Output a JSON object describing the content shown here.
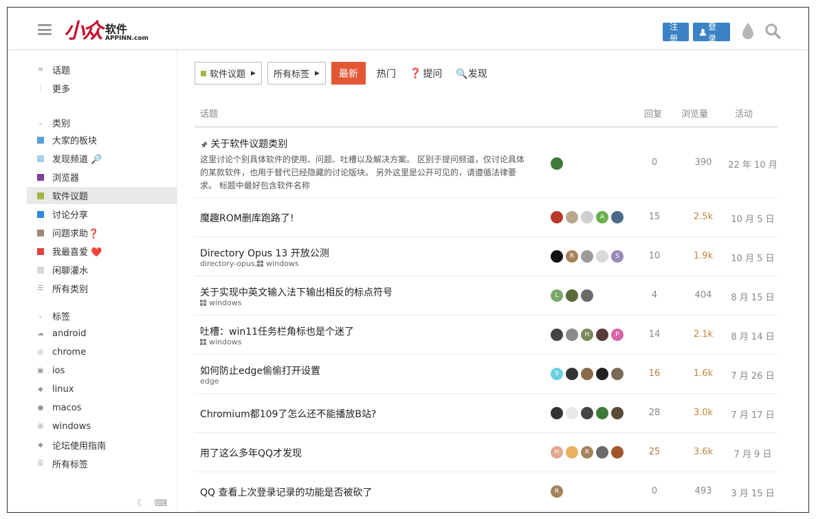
{
  "header": {
    "logo_cn": "软件",
    "logo_en": "APPINN.com",
    "signup_label": "注册",
    "login_label": "登录"
  },
  "sidebar": {
    "top_items": [
      {
        "label": "话题",
        "icon": "layers-icon"
      },
      {
        "label": "更多",
        "icon": "more-vertical-icon"
      }
    ],
    "categories_heading": "类别",
    "categories": [
      {
        "label": "大家的板块",
        "color": "#5aa0d8"
      },
      {
        "label": "发现频道 🔎",
        "color": "#a6d0e4"
      },
      {
        "label": "浏览器",
        "color": "#7d3f98"
      },
      {
        "label": "软件议题",
        "color": "#a3b642",
        "active": true
      },
      {
        "label": "讨论分享",
        "color": "#2a8ae0"
      },
      {
        "label": "问题求助❓",
        "color": "#9e8a7d"
      },
      {
        "label": "我最喜爱 ❤️",
        "color": "#e04040"
      },
      {
        "label": "闲聊灌水",
        "color": "#d8d8d8"
      },
      {
        "label": "所有类别",
        "icon": "list-icon"
      }
    ],
    "tags_heading": "标签",
    "tags": [
      {
        "label": "android",
        "icon": "android-icon"
      },
      {
        "label": "chrome",
        "icon": "chrome-icon"
      },
      {
        "label": "ios",
        "icon": "app-store-icon"
      },
      {
        "label": "linux",
        "icon": "tag-icon"
      },
      {
        "label": "macos",
        "icon": "apple-icon"
      },
      {
        "label": "windows",
        "icon": "windows-icon"
      },
      {
        "label": "论坛使用指南",
        "icon": "tag-icon"
      },
      {
        "label": "所有标签",
        "icon": "list-icon"
      }
    ]
  },
  "nav": {
    "category_dropdown": "软件议题",
    "category_color": "#a3b642",
    "tag_dropdown": "所有标签",
    "latest": "最新",
    "hot": "热门",
    "ask": "提问",
    "ask_mark": "❓",
    "discover": "🔍发现"
  },
  "table": {
    "headers": {
      "topic": "话题",
      "replies": "回复",
      "views": "浏览量",
      "activity": "活动"
    },
    "rows": [
      {
        "title": "关于软件议题类别",
        "pinned": true,
        "excerpt": "这里讨论个别具体软件的使用、问题、吐槽以及解决方案。 区别于提问频道，仅讨论具体的某款软件，也用于替代已经隐藏的讨论版块。 另外这里是公开可见的，请遵循法律要求。 标题中最好包含软件名称",
        "tags": [],
        "replies": "0",
        "views": "390",
        "activity": "22 年 10 月",
        "avatars": [
          {
            "color": "#3d7a3a",
            "letter": ""
          }
        ]
      },
      {
        "title": "魔趣ROM删库跑路了!",
        "tags": [],
        "replies": "15",
        "views": "2.5k",
        "views_hot": true,
        "activity": "10 月 5 日",
        "avatars": [
          {
            "color": "#b83a2a",
            "letter": ""
          },
          {
            "color": "#b9a88e",
            "letter": ""
          },
          {
            "color": "#cfcfcf",
            "letter": ""
          },
          {
            "color": "#6ab04c",
            "letter": "A"
          },
          {
            "color": "#4a6a8a",
            "letter": ""
          }
        ]
      },
      {
        "title": "Directory Opus 13 开放公测",
        "tags": [
          "directory-opus",
          "windows"
        ],
        "replies": "10",
        "views": "1.9k",
        "views_hot": true,
        "activity": "10 月 5 日",
        "avatars": [
          {
            "color": "#111111",
            "letter": ""
          },
          {
            "color": "#a5825a",
            "letter": "R"
          },
          {
            "color": "#9a9a9a",
            "letter": ""
          },
          {
            "color": "#d9d9d9",
            "letter": ""
          },
          {
            "color": "#9a8ab8",
            "letter": "S"
          }
        ]
      },
      {
        "title": "关于实现中英文输入法下输出相反的标点符号",
        "tags": [
          "windows"
        ],
        "replies": "4",
        "views": "404",
        "activity": "8 月 15 日",
        "avatars": [
          {
            "color": "#7aa86a",
            "letter": "L"
          },
          {
            "color": "#5a6a3a",
            "letter": ""
          },
          {
            "color": "#6a6a6a",
            "letter": ""
          }
        ]
      },
      {
        "title": "吐槽：win11任务栏角标也是个迷了",
        "tags": [
          "windows"
        ],
        "replies": "14",
        "views": "2.1k",
        "views_hot": true,
        "activity": "8 月 14 日",
        "avatars": [
          {
            "color": "#444444",
            "letter": ""
          },
          {
            "color": "#8a8a8a",
            "letter": ""
          },
          {
            "color": "#7a8a5a",
            "letter": "H"
          },
          {
            "color": "#5a3a3a",
            "letter": ""
          },
          {
            "color": "#d865a8",
            "letter": "P"
          }
        ]
      },
      {
        "title": "如何防止edge偷偷打开设置",
        "tags": [
          "edge"
        ],
        "replies": "16",
        "replies_hot": true,
        "views": "1.6k",
        "views_hot": true,
        "activity": "7 月 26 日",
        "avatars": [
          {
            "color": "#6ad0e0",
            "letter": "9"
          },
          {
            "color": "#333333",
            "letter": ""
          },
          {
            "color": "#8a6a4a",
            "letter": ""
          },
          {
            "color": "#222222",
            "letter": ""
          },
          {
            "color": "#7a6a5a",
            "letter": ""
          }
        ]
      },
      {
        "title": "Chromium都109了怎么还不能播放B站?",
        "tags": [],
        "replies": "28",
        "views": "3.0k",
        "views_hot": true,
        "activity": "7 月 17 日",
        "avatars": [
          {
            "color": "#333333",
            "letter": ""
          },
          {
            "color": "#e8e8e8",
            "letter": ""
          },
          {
            "color": "#444444",
            "letter": ""
          },
          {
            "color": "#3d7a3a",
            "letter": ""
          },
          {
            "color": "#5a4a3a",
            "letter": ""
          }
        ]
      },
      {
        "title": "用了这么多年QQ才发现",
        "tags": [],
        "replies": "25",
        "replies_hot": true,
        "views": "3.6k",
        "views_hot": true,
        "activity": "7 月 9 日",
        "avatars": [
          {
            "color": "#e0a890",
            "letter": "H"
          },
          {
            "color": "#e8b060",
            "letter": ""
          },
          {
            "color": "#a5825a",
            "letter": "R"
          },
          {
            "color": "#6a6a6a",
            "letter": ""
          },
          {
            "color": "#a0582a",
            "letter": ""
          }
        ]
      },
      {
        "title": "QQ 查看上次登录记录的功能是否被砍了",
        "tags": [],
        "replies": "0",
        "views": "493",
        "activity": "3 月 15 日",
        "avatars": [
          {
            "color": "#a5825a",
            "letter": "R"
          }
        ]
      }
    ]
  }
}
